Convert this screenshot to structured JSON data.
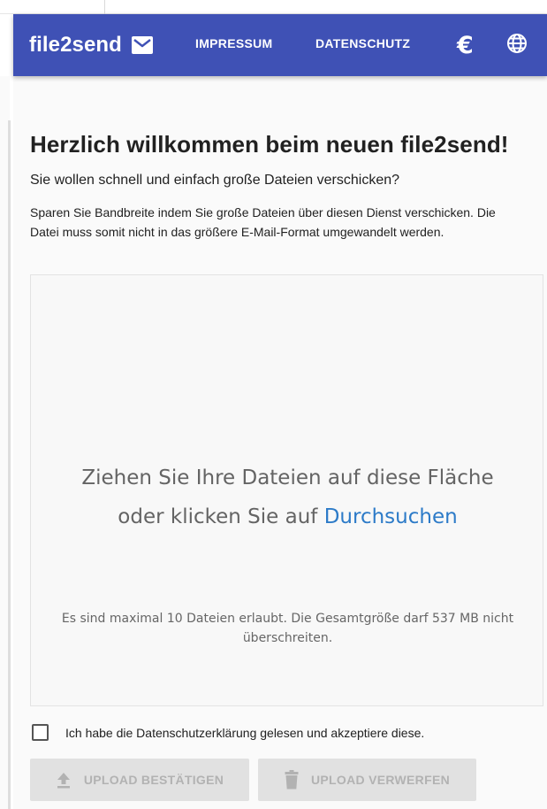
{
  "colors": {
    "primary": "#3f51b5",
    "link": "#2d7bc8",
    "disabled_bg": "#e1e1e1",
    "disabled_text": "#b2b2b2"
  },
  "header": {
    "brand": "file2send",
    "brand_icon": "mail-icon",
    "nav": {
      "impressum": "IMPRESSUM",
      "datenschutz": "DATENSCHUTZ",
      "currency_icon": "euro-icon",
      "language_icon": "globe-icon"
    }
  },
  "main": {
    "title": "Herzlich willkommen beim neuen file2send!",
    "subtitle": "Sie wollen schnell und einfach große Dateien verschicken?",
    "description": "Sparen Sie Bandbreite indem Sie große Dateien über diesen Dienst verschicken. Die Datei muss somit nicht in das größere E-Mail-Format umgewandelt werden."
  },
  "dropzone": {
    "prompt_line1": "Ziehen Sie Ihre Dateien auf diese Fläche",
    "prompt_line2_prefix": "oder klicken Sie auf",
    "browse_link": "Durchsuchen",
    "limits": "Es sind maximal 10 Dateien erlaubt. Die Gesamtgröße darf 537 MB nicht überschreiten."
  },
  "consent": {
    "label": "Ich habe die Datenschutzerklärung gelesen und akzeptiere diese.",
    "checked": false
  },
  "actions": {
    "upload_label": "UPLOAD BESTÄTIGEN",
    "upload_icon": "upload-icon",
    "discard_label": "UPLOAD VERWERFEN",
    "discard_icon": "trash-icon"
  }
}
